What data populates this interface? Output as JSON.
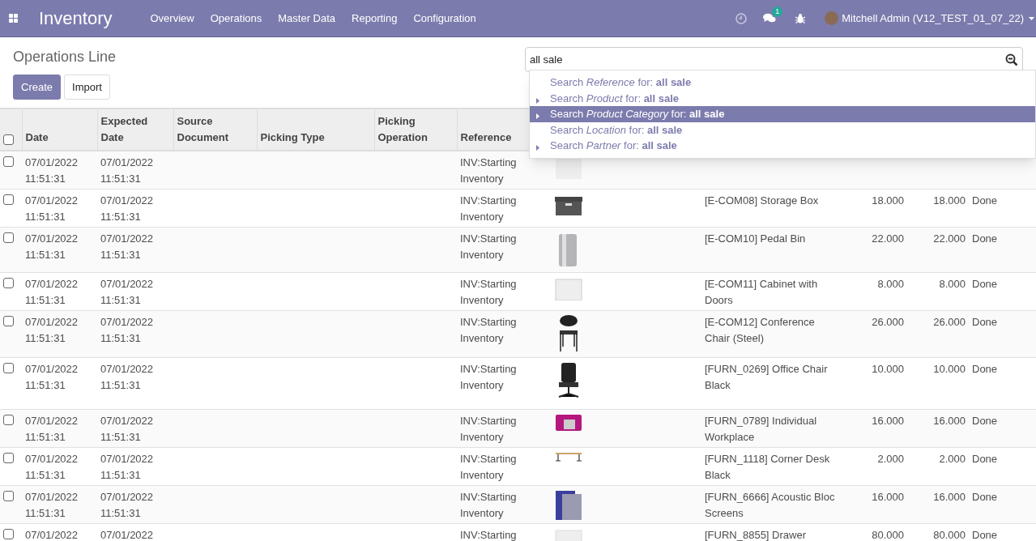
{
  "navbar": {
    "app_title": "Inventory",
    "menu": [
      "Overview",
      "Operations",
      "Master Data",
      "Reporting",
      "Configuration"
    ],
    "messages_badge": "1",
    "user": "Mitchell Admin (V12_TEST_01_07_22)"
  },
  "page_title": "Operations Line",
  "buttons": [
    {
      "label": "Create",
      "kind": "primary"
    },
    {
      "label": "Import",
      "kind": "secondary"
    }
  ],
  "search": {
    "value": "all sale"
  },
  "search_suggestions": [
    {
      "prefix": "Search ",
      "field": "Reference",
      "middle": " for: ",
      "term": "all sale",
      "expandable": false,
      "selected": false
    },
    {
      "prefix": "Search ",
      "field": "Product",
      "middle": " for: ",
      "term": "all sale",
      "expandable": true,
      "selected": false
    },
    {
      "prefix": "Search ",
      "field": "Product Category",
      "middle": " for: ",
      "term": "all sale",
      "expandable": true,
      "selected": true
    },
    {
      "prefix": "Search ",
      "field": "Location",
      "middle": " for: ",
      "term": "all sale",
      "expandable": false,
      "selected": false
    },
    {
      "prefix": "Search ",
      "field": "Partner",
      "middle": " for: ",
      "term": "all sale",
      "expandable": true,
      "selected": false
    }
  ],
  "table": {
    "select_all_checked": false,
    "columns": [
      "Date",
      "Expected Date",
      "Source Document",
      "Picking Type",
      "Picking Operation",
      "Reference"
    ],
    "rows": [
      {
        "checked": false,
        "date": "07/01/2022 11:51:31",
        "expected_date": "07/01/2022 11:51:31",
        "reference": "INV:Starting Inventory"
      },
      {
        "checked": false,
        "date": "07/01/2022 11:51:31",
        "expected_date": "07/01/2022 11:51:31",
        "reference": "INV:Starting Inventory",
        "product": "[E-COM08] Storage Box",
        "quantity": "18.000",
        "quantity_done": "18.000",
        "status": "Done"
      },
      {
        "checked": false,
        "date": "07/01/2022 11:51:31",
        "expected_date": "07/01/2022 11:51:31",
        "reference": "INV:Starting Inventory",
        "product": "[E-COM10] Pedal Bin",
        "quantity": "22.000",
        "quantity_done": "22.000",
        "status": "Done"
      },
      {
        "checked": false,
        "date": "07/01/2022 11:51:31",
        "expected_date": "07/01/2022 11:51:31",
        "reference": "INV:Starting Inventory",
        "product": "[E-COM11] Cabinet with Doors",
        "quantity": "8.000",
        "quantity_done": "8.000",
        "status": "Done"
      },
      {
        "checked": false,
        "date": "07/01/2022 11:51:31",
        "expected_date": "07/01/2022 11:51:31",
        "reference": "INV:Starting Inventory",
        "product": "[E-COM12] Conference Chair (Steel)",
        "quantity": "26.000",
        "quantity_done": "26.000",
        "status": "Done"
      },
      {
        "checked": false,
        "date": "07/01/2022 11:51:31",
        "expected_date": "07/01/2022 11:51:31",
        "reference": "INV:Starting Inventory",
        "product": "[FURN_0269] Office Chair Black",
        "quantity": "10.000",
        "quantity_done": "10.000",
        "status": "Done"
      },
      {
        "checked": false,
        "date": "07/01/2022 11:51:31",
        "expected_date": "07/01/2022 11:51:31",
        "reference": "INV:Starting Inventory",
        "product": "[FURN_0789] Individual Workplace",
        "quantity": "16.000",
        "quantity_done": "16.000",
        "status": "Done"
      },
      {
        "checked": false,
        "date": "07/01/2022 11:51:31",
        "expected_date": "07/01/2022 11:51:31",
        "reference": "INV:Starting Inventory",
        "product": "[FURN_1118] Corner Desk Black",
        "quantity": "2.000",
        "quantity_done": "2.000",
        "status": "Done"
      },
      {
        "checked": false,
        "date": "07/01/2022 11:51:31",
        "expected_date": "07/01/2022 11:51:31",
        "reference": "INV:Starting Inventory",
        "product": "[FURN_6666] Acoustic Bloc Screens",
        "quantity": "16.000",
        "quantity_done": "16.000",
        "status": "Done"
      },
      {
        "checked": false,
        "date": "07/01/2022",
        "expected_date": "07/01/2022",
        "reference": "INV:Starting",
        "product": "[FURN_8855] Drawer",
        "quantity": "80.000",
        "quantity_done": "80.000",
        "status": "Done"
      }
    ]
  }
}
